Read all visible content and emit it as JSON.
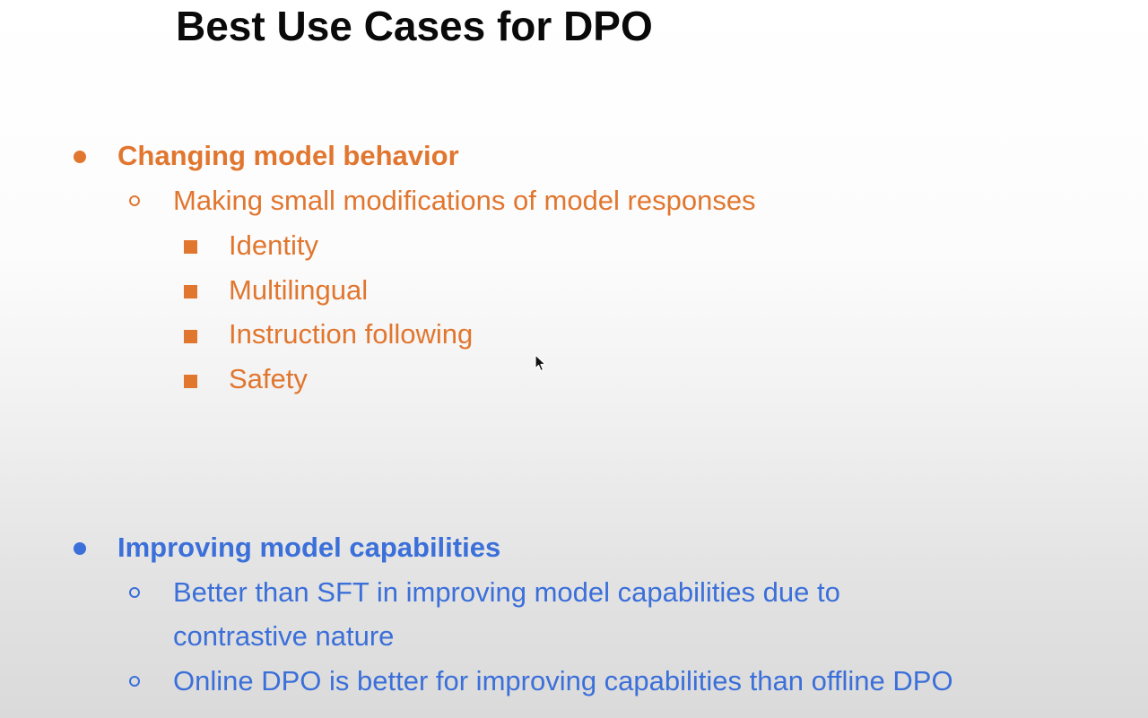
{
  "slide": {
    "title": "Best Use Cases for DPO",
    "sections": [
      {
        "heading": "Changing model behavior",
        "subitems": [
          {
            "text": "Making small modifications of model responses",
            "subitems": [
              "Identity",
              "Multilingual",
              "Instruction following",
              "Safety"
            ]
          }
        ]
      },
      {
        "heading": "Improving model capabilities",
        "subitems": [
          {
            "text_line1": "Better than SFT in improving model capabilities due to",
            "text_line2": "contrastive nature"
          },
          {
            "text": "Online DPO is better for improving capabilities than offline DPO"
          }
        ]
      }
    ]
  },
  "colors": {
    "section1": "#e1762f",
    "section2": "#3b6fd9",
    "title": "#0a0a0a"
  },
  "icons": {
    "level1_bullet": "filled-circle-bullet",
    "level2_bullet": "hollow-circle-bullet",
    "level3_bullet": "filled-square-bullet",
    "cursor": "mouse-pointer-icon"
  }
}
